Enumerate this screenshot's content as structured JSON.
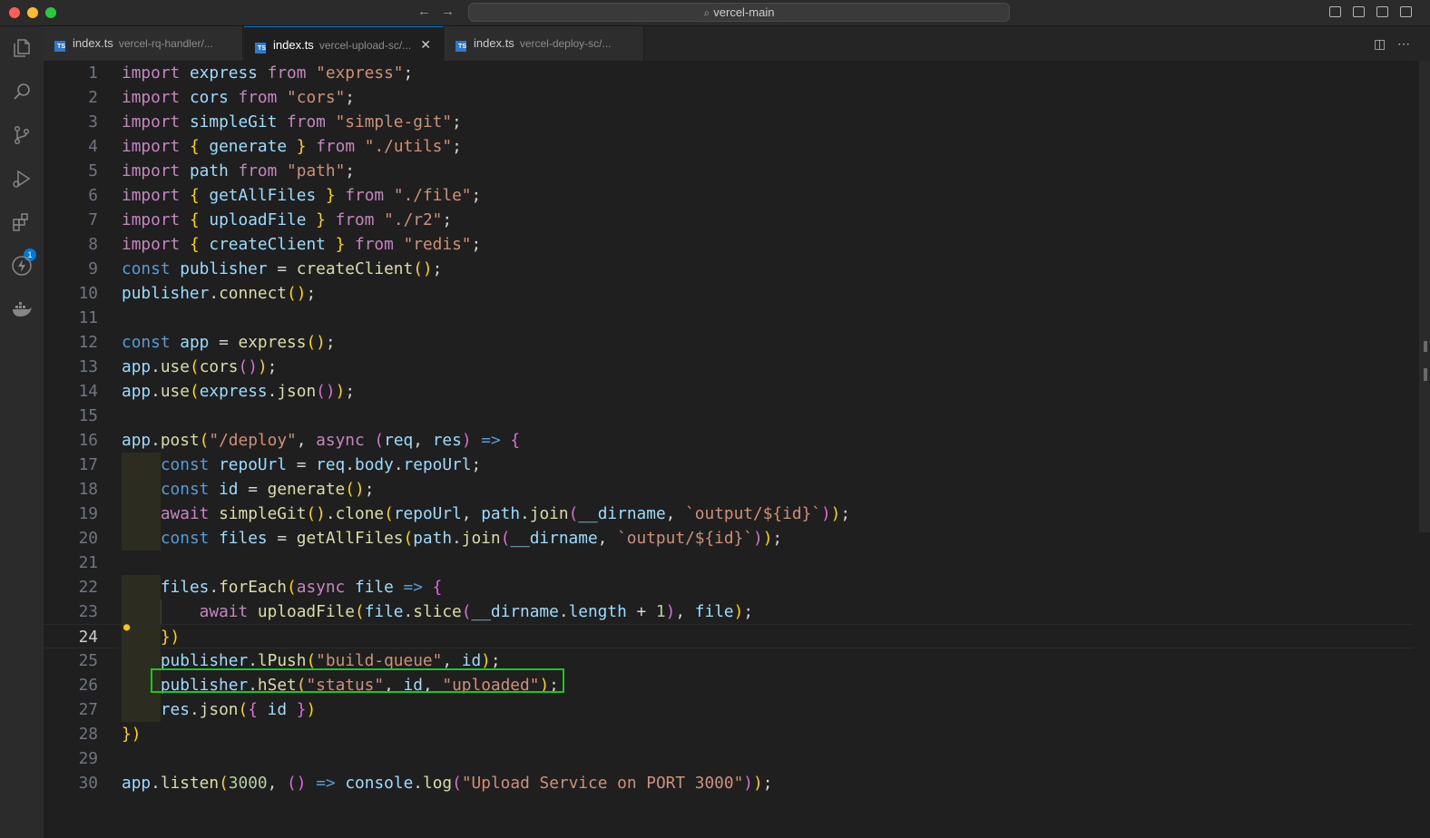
{
  "window": {
    "search_text": "vercel-main"
  },
  "tabs": [
    {
      "file": "index.ts",
      "path": "vercel-rq-handler/...",
      "active": false
    },
    {
      "file": "index.ts",
      "path": "vercel-upload-sc/...",
      "active": true
    },
    {
      "file": "index.ts",
      "path": "vercel-deploy-sc/...",
      "active": false
    }
  ],
  "activity_bar": {
    "items": [
      "files-icon",
      "search-icon",
      "source-control-icon",
      "run-debug-icon",
      "extensions-icon",
      "lightning-icon",
      "docker-icon"
    ],
    "extensions_badge": "1"
  },
  "editor": {
    "language": "typescript",
    "current_line": 24,
    "highlighted_line": 26,
    "lines": [
      "import express from \"express\";",
      "import cors from \"cors\";",
      "import simpleGit from \"simple-git\";",
      "import { generate } from \"./utils\";",
      "import path from \"path\";",
      "import { getAllFiles } from \"./file\";",
      "import { uploadFile } from \"./r2\";",
      "import { createClient } from \"redis\";",
      "const publisher = createClient();",
      "publisher.connect();",
      "",
      "const app = express();",
      "app.use(cors());",
      "app.use(express.json());",
      "",
      "app.post(\"/deploy\", async (req, res) => {",
      "    const repoUrl = req.body.repoUrl;",
      "    const id = generate();",
      "    await simpleGit().clone(repoUrl, path.join(__dirname, `output/${id}`));",
      "    const files = getAllFiles(path.join(__dirname, `output/${id}`));",
      "",
      "    files.forEach(async file => {",
      "        await uploadFile(file.slice(__dirname.length + 1), file);",
      "    })",
      "    publisher.lPush(\"build-queue\", id);",
      "    publisher.hSet(\"status\", id, \"uploaded\");",
      "    res.json({ id })",
      "})",
      "",
      "app.listen(3000, () => console.log(\"Upload Service on PORT 3000\"));"
    ]
  },
  "colors": {
    "keyword": "#c586c0",
    "string": "#ce9178",
    "declaration": "#569cd6",
    "variable": "#9cdcfe",
    "function": "#dcdcaa",
    "number": "#b5cea8",
    "highlight_box": "#22c32a",
    "accent": "#0078d4"
  }
}
